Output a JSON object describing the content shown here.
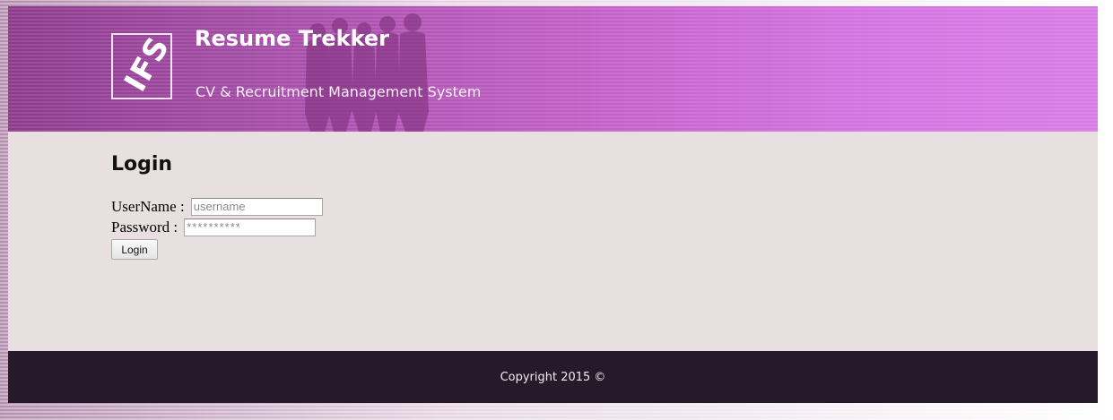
{
  "header": {
    "logo_text": "IFS",
    "title": "Resume Trekker",
    "subtitle": "CV & Recruitment Management System"
  },
  "login": {
    "heading": "Login",
    "username_label": "UserName :",
    "username_placeholder": "username",
    "password_label": "Password :",
    "password_placeholder": "**********",
    "button_label": "Login"
  },
  "footer": {
    "copyright": "Copyright 2015 ©"
  },
  "colors": {
    "header_left": "#8c3a8c",
    "header_right": "#d77be4",
    "content_bg": "#e8e0e0",
    "footer_bg": "#26192a"
  }
}
